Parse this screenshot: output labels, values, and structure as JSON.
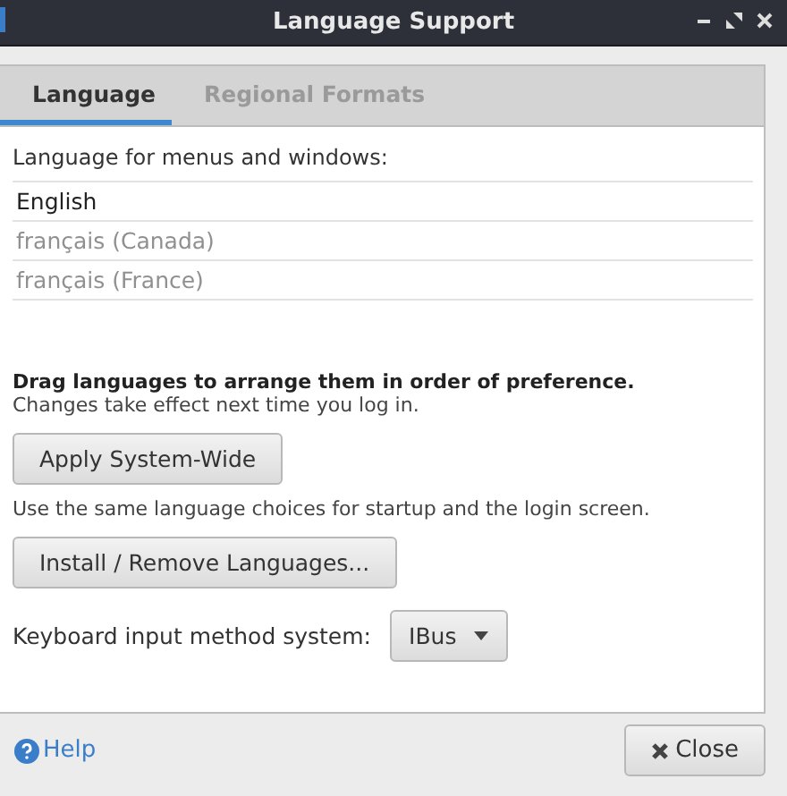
{
  "window": {
    "title": "Language Support"
  },
  "tabs": [
    {
      "label": "Language",
      "selected": true
    },
    {
      "label": "Regional Formats",
      "selected": false
    }
  ],
  "languages_heading": "Language for menus and windows:",
  "languages": [
    {
      "name": "English",
      "greyed": false
    },
    {
      "name": "français (Canada)",
      "greyed": true
    },
    {
      "name": "français (France)",
      "greyed": true
    }
  ],
  "drag_hint": "Drag languages to arrange them in order of preference.",
  "changes_note": "Changes take effect next time you log in.",
  "apply_button": "Apply System-Wide",
  "apply_note": "Use the same language choices for startup and the login screen.",
  "install_button": "Install / Remove Languages...",
  "input_method": {
    "label": "Keyboard input method system:",
    "value": "IBus"
  },
  "help_link": "Help",
  "close_button": "Close"
}
